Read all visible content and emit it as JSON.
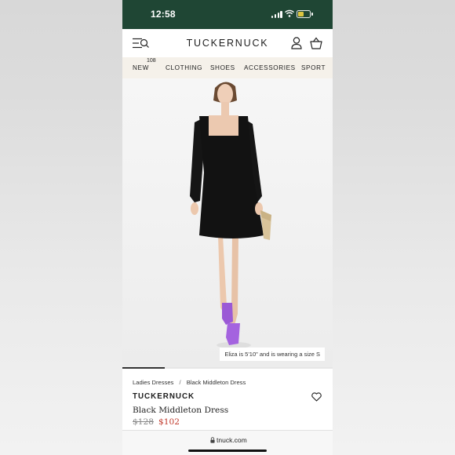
{
  "status_bar": {
    "time": "12:58",
    "battery_color": "#f1d342",
    "background": "#1f4634"
  },
  "header": {
    "logo": "TUCKERNUCK",
    "icons": [
      "menu-search-icon",
      "account-icon",
      "shopping-basket-icon"
    ]
  },
  "nav": {
    "items": [
      "NEW",
      "CLOTHING",
      "SHOES",
      "ACCESSORIES",
      "SPORT"
    ],
    "new_count": "108",
    "background": "#f5f1ea"
  },
  "gallery": {
    "caption": "Eliza is 5'10\" and is wearing a size S",
    "active_index": 1,
    "total_images": 5
  },
  "product": {
    "breadcrumb": [
      "Ladies Dresses",
      "Black Middleton Dress"
    ],
    "breadcrumb_separator": "/",
    "brand": "TUCKERNUCK",
    "name": "Black Middleton Dress",
    "price_original": "$128",
    "price_sale": "$102",
    "sale_color": "#c0392b"
  },
  "browser": {
    "url": "tnuck.com"
  }
}
